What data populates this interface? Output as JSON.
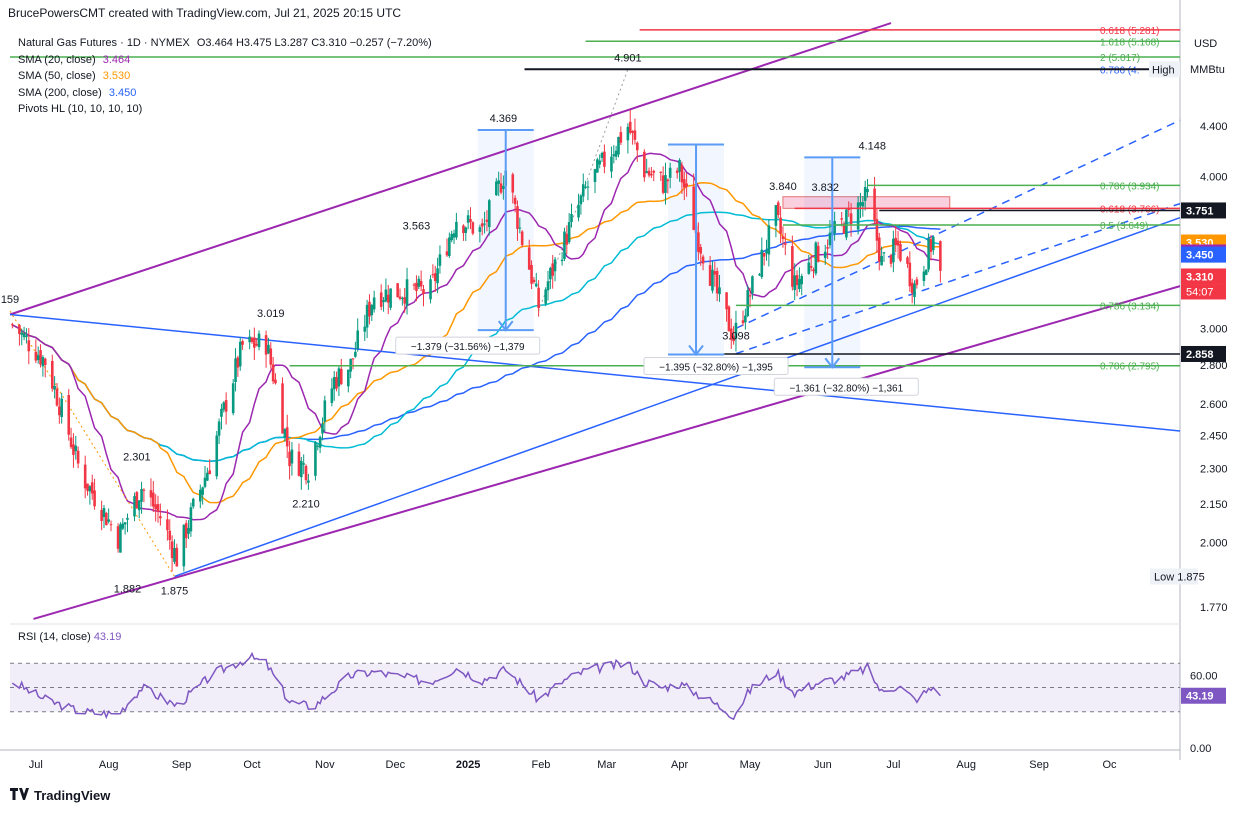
{
  "header": {
    "attribution": "BrucePowersCMT created with TradingView.com, Jul 21, 2025 20:15 UTC"
  },
  "legend": {
    "symbol": "Natural Gas Futures · 1D · NYMEX",
    "ohlc": "O3.464  H3.475  L3.287  C3.310  −0.257 (−7.20%)",
    "sma20_label": "SMA (20, close)",
    "sma20_value": "3.464",
    "sma50_label": "SMA (50, close)",
    "sma50_value": "3.530",
    "sma200_label": "SMA (200, close)",
    "sma200_value": "3.450",
    "pivots_label": "Pivots HL (10, 10, 10, 10)"
  },
  "rsi": {
    "label": "RSI (14, close)",
    "value": "43.19"
  },
  "footer": {
    "brand": "TradingView"
  },
  "colors": {
    "up": "#089981",
    "down": "#f23645",
    "sma20": "#9c27b0",
    "sma50": "#ff9800",
    "sma200": "#2962ff",
    "ema": "#00bcd4",
    "channel": "#9c27b0",
    "trend": "#2962ff",
    "fib_green": "#4caf50",
    "rsi": "#7e57c2"
  },
  "chart_data": {
    "type": "candlestick",
    "title": "Natural Gas Futures · 1D · NYMEX",
    "currency": "USD",
    "unit": "MMBtu",
    "y_scale": "log",
    "ylim": [
      1.72,
      5.3
    ],
    "y_ticks": [
      "4.400",
      "4.000",
      "3.000",
      "2.800",
      "2.600",
      "2.450",
      "2.300",
      "2.150",
      "2.000",
      "1.770"
    ],
    "x_ticks": [
      "Jul",
      "Aug",
      "Sep",
      "Oct",
      "Nov",
      "Dec",
      "2025",
      "Feb",
      "Mar",
      "Apr",
      "May",
      "Jun",
      "Jul",
      "Aug",
      "Sep",
      "Oc"
    ],
    "x_range": [
      "2024-06-20",
      "2025-10-31"
    ],
    "price_path": [
      [
        "2024-06-21",
        3.02
      ],
      [
        "2024-07-05",
        2.82
      ],
      [
        "2024-07-20",
        2.28
      ],
      [
        "2024-08-05",
        2.02
      ],
      [
        "2024-08-15",
        2.22
      ],
      [
        "2024-08-23",
        2.1
      ],
      [
        "2024-08-30",
        1.94
      ],
      [
        "2024-09-13",
        2.32
      ],
      [
        "2024-09-27",
        2.9
      ],
      [
        "2024-10-07",
        2.92
      ],
      [
        "2024-10-17",
        2.35
      ],
      [
        "2024-10-25",
        2.3
      ],
      [
        "2024-11-05",
        2.72
      ],
      [
        "2024-11-12",
        2.8
      ],
      [
        "2024-11-22",
        3.2
      ],
      [
        "2024-12-05",
        3.22
      ],
      [
        "2024-12-16",
        3.22
      ],
      [
        "2024-12-27",
        3.7
      ],
      [
        "2025-01-07",
        3.6
      ],
      [
        "2025-01-17",
        4.05
      ],
      [
        "2025-01-24",
        3.55
      ],
      [
        "2025-01-31",
        3.13
      ],
      [
        "2025-02-10",
        3.5
      ],
      [
        "2025-02-20",
        3.9
      ],
      [
        "2025-03-03",
        4.2
      ],
      [
        "2025-03-10",
        4.4
      ],
      [
        "2025-03-17",
        4.05
      ],
      [
        "2025-03-25",
        3.95
      ],
      [
        "2025-04-01",
        4.05
      ],
      [
        "2025-04-08",
        3.6
      ],
      [
        "2025-04-17",
        3.2
      ],
      [
        "2025-04-24",
        2.95
      ],
      [
        "2025-05-01",
        3.2
      ],
      [
        "2025-05-12",
        3.7
      ],
      [
        "2025-05-20",
        3.25
      ],
      [
        "2025-05-30",
        3.47
      ],
      [
        "2025-06-09",
        3.65
      ],
      [
        "2025-06-20",
        3.85
      ],
      [
        "2025-06-26",
        3.4
      ],
      [
        "2025-07-03",
        3.5
      ],
      [
        "2025-07-10",
        3.25
      ],
      [
        "2025-07-18",
        3.55
      ],
      [
        "2025-07-21",
        3.31
      ]
    ],
    "pivot_labels": [
      {
        "date": "2024-06-20",
        "price": 3.1,
        "text": "159"
      },
      {
        "date": "2024-08-09",
        "price": 1.882,
        "text": "1.882"
      },
      {
        "date": "2024-08-29",
        "price": 1.875,
        "text": "1.875"
      },
      {
        "date": "2024-08-13",
        "price": 2.301,
        "text": "2.301"
      },
      {
        "date": "2024-10-09",
        "price": 3.019,
        "text": "3.019"
      },
      {
        "date": "2024-10-24",
        "price": 2.21,
        "text": "2.210"
      },
      {
        "date": "2024-12-10",
        "price": 3.563,
        "text": "3.563"
      },
      {
        "date": "2025-01-16",
        "price": 4.369,
        "text": "4.369"
      },
      {
        "date": "2025-03-10",
        "price": 4.901,
        "text": "4.901"
      },
      {
        "date": "2025-04-25",
        "price": 3.04,
        "text": "3.098"
      },
      {
        "date": "2025-05-15",
        "price": 3.84,
        "text": "3.840"
      },
      {
        "date": "2025-06-02",
        "price": 3.832,
        "text": "3.832"
      },
      {
        "date": "2025-06-22",
        "price": 4.148,
        "text": "4.148"
      }
    ],
    "fib_levels": [
      {
        "ratio": "0.618",
        "price": 5.281,
        "text": "0.618 (5.281)",
        "color": "#f23645"
      },
      {
        "ratio": "1.618",
        "price": 5.168,
        "text": "1.618 (5.168)",
        "color": "#4caf50"
      },
      {
        "ratio": "2",
        "price": 5.017,
        "text": "2 (5.017)",
        "color": "#4caf50"
      },
      {
        "ratio": "0.786",
        "price": 4.901,
        "text": "0.786 (4.",
        "color": "#2962ff"
      },
      {
        "ratio": "0.786",
        "price": 3.934,
        "text": "0.786 (3.934)",
        "color": "#4caf50"
      },
      {
        "ratio": "0.618",
        "price": 3.766,
        "text": "0.618 (3.766)",
        "color": "#f23645"
      },
      {
        "ratio": "0.5",
        "price": 3.649,
        "text": "0.5 (3.649)",
        "color": "#4caf50"
      },
      {
        "ratio": "0.786",
        "price": 3.134,
        "text": "0.786 (3.134)",
        "color": "#4caf50"
      },
      {
        "ratio": "0.786",
        "price": 2.795,
        "text": "0.786 (2.795)",
        "color": "#4caf50"
      }
    ],
    "measurements": [
      {
        "text": "−1.379 (−31.56%) −1,379",
        "date_from": "2025-01-17",
        "price_from": 4.369,
        "price_to": 2.99
      },
      {
        "text": "−1.395 (−32.80%) −1,395",
        "date_from": "2025-04-08",
        "price_from": 4.25,
        "price_to": 2.855
      },
      {
        "text": "−1.361 (−32.80%) −1,361",
        "date_from": "2025-06-05",
        "price_from": 4.148,
        "price_to": 2.787
      }
    ],
    "price_labels": [
      {
        "price": 3.751,
        "text": "3.751",
        "bg": "#131722"
      },
      {
        "price": 3.53,
        "text": "3.530",
        "bg": "#ff9800"
      },
      {
        "price": 3.464,
        "text": "3.464",
        "bg": "#9c27b0"
      },
      {
        "price": 3.45,
        "text": "3.450",
        "bg": "#2962ff"
      },
      {
        "price": 3.31,
        "text": "3.310",
        "bg": "#f23645"
      },
      {
        "price": 2.858,
        "text": "2.858",
        "bg": "#131722"
      }
    ],
    "countdown": "54:07",
    "high_label": "High",
    "low_label": "Low",
    "low_value": "1.875",
    "rsi_ticks": [
      "60.00",
      "0.00"
    ],
    "rsi_ylim": [
      0,
      100
    ],
    "rsi_bands": [
      70,
      50,
      30
    ],
    "rsi_path": [
      [
        "2024-06-21",
        55
      ],
      [
        "2024-07-05",
        40
      ],
      [
        "2024-07-20",
        30
      ],
      [
        "2024-08-05",
        28
      ],
      [
        "2024-08-15",
        50
      ],
      [
        "2024-08-25",
        40
      ],
      [
        "2024-08-30",
        35
      ],
      [
        "2024-09-15",
        62
      ],
      [
        "2024-09-30",
        75
      ],
      [
        "2024-10-07",
        70
      ],
      [
        "2024-10-17",
        38
      ],
      [
        "2024-10-27",
        34
      ],
      [
        "2024-11-12",
        60
      ],
      [
        "2024-11-22",
        63
      ],
      [
        "2024-12-05",
        58
      ],
      [
        "2024-12-16",
        55
      ],
      [
        "2024-12-27",
        66
      ],
      [
        "2025-01-07",
        56
      ],
      [
        "2025-01-17",
        65
      ],
      [
        "2025-01-31",
        40
      ],
      [
        "2025-02-10",
        55
      ],
      [
        "2025-02-20",
        64
      ],
      [
        "2025-03-03",
        68
      ],
      [
        "2025-03-10",
        70
      ],
      [
        "2025-03-17",
        55
      ],
      [
        "2025-03-25",
        50
      ],
      [
        "2025-04-01",
        53
      ],
      [
        "2025-04-15",
        38
      ],
      [
        "2025-04-24",
        27
      ],
      [
        "2025-05-01",
        48
      ],
      [
        "2025-05-12",
        63
      ],
      [
        "2025-05-20",
        46
      ],
      [
        "2025-05-30",
        54
      ],
      [
        "2025-06-09",
        58
      ],
      [
        "2025-06-20",
        66
      ],
      [
        "2025-06-26",
        46
      ],
      [
        "2025-07-03",
        52
      ],
      [
        "2025-07-10",
        40
      ],
      [
        "2025-07-18",
        50
      ],
      [
        "2025-07-21",
        43.19
      ]
    ]
  }
}
